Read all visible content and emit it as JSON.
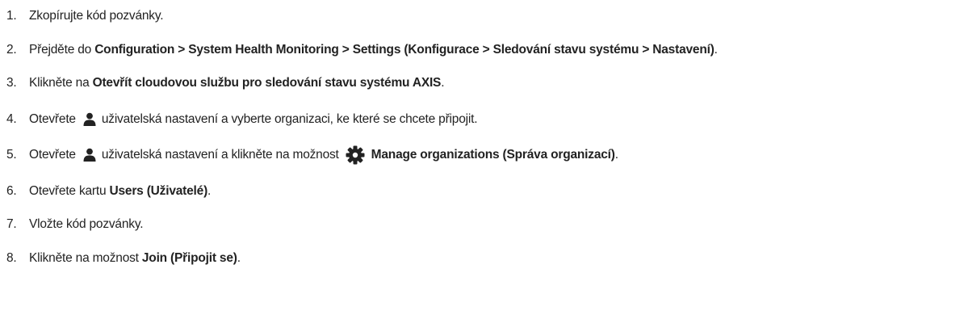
{
  "steps": [
    {
      "num": "1.",
      "text": "Zkopírujte kód pozvánky."
    },
    {
      "num": "2.",
      "pre": "Přejděte do ",
      "bold": "Configuration > System Health Monitoring > Settings (Konfigurace > Sledování stavu systému > Nastavení)",
      "post": "."
    },
    {
      "num": "3.",
      "pre": "Klikněte na ",
      "bold": "Otevřít cloudovou službu pro sledování stavu systému AXIS",
      "post": "."
    },
    {
      "num": "4.",
      "pre": "Otevřete",
      "icon": "user-icon",
      "post": "uživatelská nastavení a vyberte organizaci, ke které se chcete připojit."
    },
    {
      "num": "5.",
      "pre": "Otevřete",
      "icon": "user-icon",
      "mid": "uživatelská nastavení a klikněte na možnost",
      "icon2": "gear-icon",
      "bold": "Manage organizations (Správa organizací)",
      "post": "."
    },
    {
      "num": "6.",
      "pre": "Otevřete kartu ",
      "bold": "Users (Uživatelé)",
      "post": "."
    },
    {
      "num": "7.",
      "text": "Vložte kód pozvánky."
    },
    {
      "num": "8.",
      "pre": "Klikněte na možnost ",
      "bold": "Join (Připojit se)",
      "post": "."
    }
  ],
  "colors": {
    "text": "#222222",
    "background": "#ffffff"
  }
}
